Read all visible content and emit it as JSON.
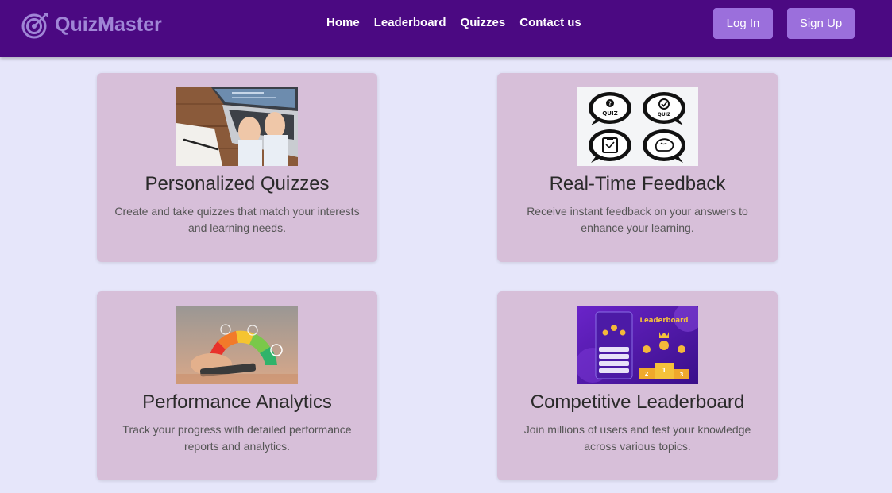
{
  "brand": {
    "name": "QuizMaster",
    "icon": "target-icon",
    "color": "#a086d6"
  },
  "nav": {
    "links": [
      "Home",
      "Leaderboard",
      "Quizzes",
      "Contact us"
    ],
    "login_label": "Log In",
    "signup_label": "Sign Up"
  },
  "colors": {
    "navbar": "#4b0982",
    "background": "#e6e6fa",
    "card": "#d7bfd9",
    "button": "#9b6fdc"
  },
  "features": [
    {
      "title": "Personalized Quizzes",
      "description": "Create and take quizzes that match your interests and learning needs.",
      "image": "laptop-typing-photo"
    },
    {
      "title": "Real-Time Feedback",
      "description": "Receive instant feedback on your answers to enhance your learning.",
      "image": "quiz-icons-image"
    },
    {
      "title": "Performance Analytics",
      "description": "Track your progress with detailed performance reports and analytics.",
      "image": "analytics-gauge-photo"
    },
    {
      "title": "Competitive Leaderboard",
      "description": "Join millions of users and test your knowledge across various topics.",
      "image": "leaderboard-illustration"
    }
  ],
  "image_text": {
    "quiz_label_1": "QUIZ",
    "quiz_label_2": "QUIZ",
    "leaderboard_title": "Leaderboard",
    "podium": [
      "2",
      "1",
      "3"
    ]
  }
}
